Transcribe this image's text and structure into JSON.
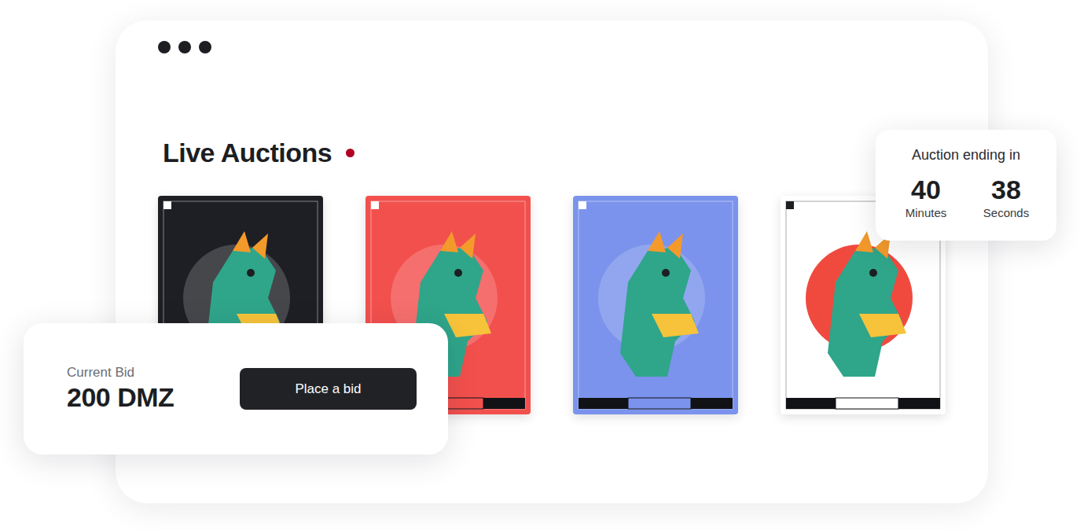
{
  "section": {
    "title": "Live Auctions",
    "live": true
  },
  "cards": [
    {
      "color": "#1e1f24"
    },
    {
      "color": "#f2504d"
    },
    {
      "color": "#7b93ec"
    },
    {
      "color": "#ffffff"
    }
  ],
  "bid": {
    "label": "Current Bid",
    "amount": "200 DMZ",
    "button": "Place a bid"
  },
  "timer": {
    "label": "Auction ending in",
    "units": [
      {
        "value": "40",
        "unit": "Minutes"
      },
      {
        "value": "38",
        "unit": "Seconds"
      }
    ]
  }
}
